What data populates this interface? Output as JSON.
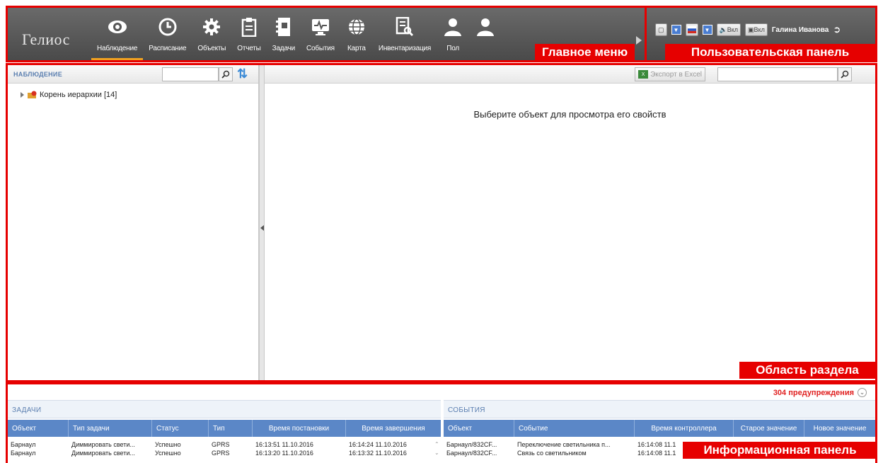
{
  "app": {
    "logo_text": "Гелиос"
  },
  "menu": {
    "items": [
      {
        "label": "Наблюдение",
        "icon": "eye-icon",
        "active": true
      },
      {
        "label": "Расписание",
        "icon": "clock-icon"
      },
      {
        "label": "Объекты",
        "icon": "gear-icon"
      },
      {
        "label": "Отчеты",
        "icon": "clipboard-icon"
      },
      {
        "label": "Задачи",
        "icon": "notebook-icon"
      },
      {
        "label": "События",
        "icon": "monitor-pulse-icon"
      },
      {
        "label": "Карта",
        "icon": "globe-icon"
      },
      {
        "label": "Инвентаризация",
        "icon": "document-search-icon"
      },
      {
        "label": "Пол",
        "icon": "user-icon"
      },
      {
        "label": "",
        "icon": "user-icon"
      }
    ]
  },
  "user_panel": {
    "sound_label": "Вкл",
    "display_label": "Вкл",
    "username": "Галина Иванова"
  },
  "annotations": {
    "main_menu": "Главное меню",
    "user_panel": "Пользовательская панель",
    "section_area": "Область раздела",
    "info_panel": "Информационная панель"
  },
  "section": {
    "left_title": "НАБЛЮДЕНИЕ",
    "tree_root": "Корень иерархии [14]",
    "export_label": "Экспорт в Excel",
    "hint": "Выберите объект для просмотра его свойств"
  },
  "info": {
    "warnings": "304 предупреждения",
    "tasks": {
      "title": "ЗАДАЧИ",
      "columns": [
        "Объект",
        "Тип задачи",
        "Статус",
        "Тип",
        "Время постановки",
        "Время завершения"
      ],
      "rows": [
        [
          "Барнаул",
          "Диммировать свети...",
          "Успешно",
          "GPRS",
          "16:13:51 11.10.2016",
          "16:14:24 11.10.2016"
        ],
        [
          "Барнаул",
          "Диммировать свети...",
          "Успешно",
          "GPRS",
          "16:13:20 11.10.2016",
          "16:13:32 11.10.2016"
        ]
      ]
    },
    "events": {
      "title": "СОБЫТИЯ",
      "columns": [
        "Объект",
        "Событие",
        "Время контроллера",
        "Старое значение",
        "Новое значение"
      ],
      "rows": [
        [
          "Барнаул/832CF...",
          "Переключение светильника п...",
          "16:14:08 11.1"
        ],
        [
          "Барнаул/832CF...",
          "Связь со светильником",
          "16:14:08 11.1"
        ]
      ]
    }
  }
}
